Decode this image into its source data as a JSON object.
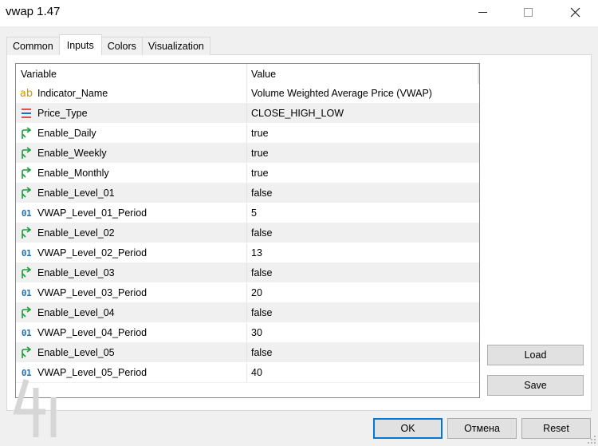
{
  "window": {
    "title": "vwap 1.47"
  },
  "tabs": [
    {
      "label": "Common",
      "active": false
    },
    {
      "label": "Inputs",
      "active": true
    },
    {
      "label": "Colors",
      "active": false
    },
    {
      "label": "Visualization",
      "active": false
    }
  ],
  "grid": {
    "columns": [
      "Variable",
      "Value"
    ],
    "rows": [
      {
        "icon": "string-icon",
        "variable": "Indicator_Name",
        "value": "Volume Weighted Average Price (VWAP)"
      },
      {
        "icon": "enum-icon",
        "variable": "Price_Type",
        "value": "CLOSE_HIGH_LOW"
      },
      {
        "icon": "bool-icon",
        "variable": "Enable_Daily",
        "value": "true"
      },
      {
        "icon": "bool-icon",
        "variable": "Enable_Weekly",
        "value": "true"
      },
      {
        "icon": "bool-icon",
        "variable": "Enable_Monthly",
        "value": "true"
      },
      {
        "icon": "bool-icon",
        "variable": "Enable_Level_01",
        "value": "false"
      },
      {
        "icon": "int-icon",
        "variable": "VWAP_Level_01_Period",
        "value": "5"
      },
      {
        "icon": "bool-icon",
        "variable": "Enable_Level_02",
        "value": "false"
      },
      {
        "icon": "int-icon",
        "variable": "VWAP_Level_02_Period",
        "value": "13"
      },
      {
        "icon": "bool-icon",
        "variable": "Enable_Level_03",
        "value": "false"
      },
      {
        "icon": "int-icon",
        "variable": "VWAP_Level_03_Period",
        "value": "20"
      },
      {
        "icon": "bool-icon",
        "variable": "Enable_Level_04",
        "value": "false"
      },
      {
        "icon": "int-icon",
        "variable": "VWAP_Level_04_Period",
        "value": "30"
      },
      {
        "icon": "bool-icon",
        "variable": "Enable_Level_05",
        "value": "false"
      },
      {
        "icon": "int-icon",
        "variable": "VWAP_Level_05_Period",
        "value": "40"
      }
    ]
  },
  "icons": {
    "string_text": "ab",
    "int_text": "01"
  },
  "side_buttons": {
    "load": "Load",
    "save": "Save"
  },
  "footer": {
    "ok": "OK",
    "cancel": "Отмена",
    "reset": "Reset"
  },
  "colors": {
    "accent": "#0078d7",
    "bool_icon": "#1a9c3a",
    "string_icon": "#d0931a",
    "int_icon": "#1e6fb3",
    "enum_icon": "#d9534f"
  }
}
